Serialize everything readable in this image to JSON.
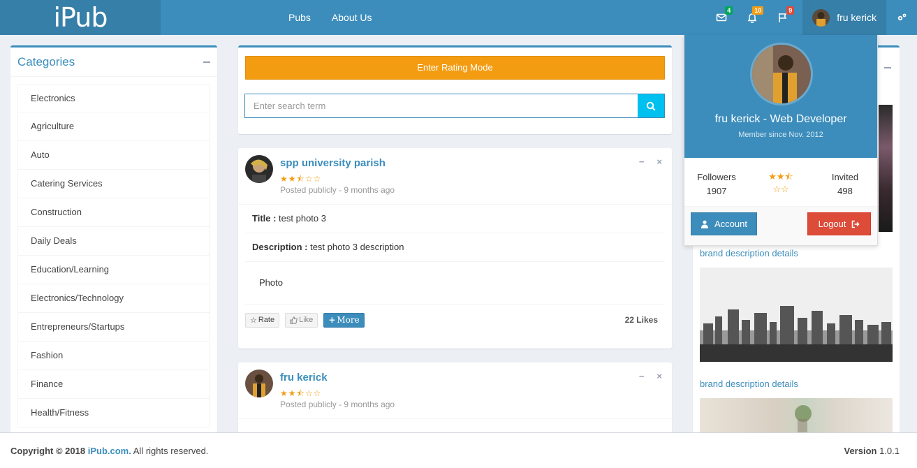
{
  "app": {
    "logo": "iPub"
  },
  "nav": {
    "links": [
      "Pubs",
      "About Us"
    ],
    "badges": {
      "messages": "4",
      "notifications": "10",
      "tasks": "9"
    },
    "user_name": "fru kerick",
    "colors": {
      "header": "#3c8dbc",
      "logo_bg": "#367fa9"
    }
  },
  "categories": {
    "title": "Categories",
    "items": [
      "Electronics",
      "Agriculture",
      "Auto",
      "Catering Services",
      "Construction",
      "Daily Deals",
      "Education/Learning",
      "Electronics/Technology",
      "Entrepreneurs/Startups",
      "Fashion",
      "Finance",
      "Health/Fitness"
    ]
  },
  "search": {
    "rating_button": "Enter Rating Mode",
    "placeholder": "Enter search term",
    "colors": {
      "rating": "#f39c12",
      "search_btn": "#00c0ef"
    }
  },
  "posts": [
    {
      "author": "spp university parish",
      "rating_stars": "★★⯪☆☆",
      "meta": "Posted publicly - 9 months ago",
      "title_label": "Title :",
      "title_value": " test photo 3",
      "desc_label": "Description :",
      "desc_value": " test photo 3 description",
      "media_label": "Photo",
      "rate_label": "Rate",
      "like_label": "Like",
      "more_label": "More",
      "likes": "22 Likes"
    },
    {
      "author": "fru kerick",
      "rating_stars": "★★⯪☆☆",
      "meta": "Posted publicly - 9 months ago"
    }
  ],
  "right_panel": {
    "brand_links": [
      "brand description details",
      "brand description details"
    ]
  },
  "user_dropdown": {
    "name": "fru kerick - Web Developer",
    "member_since": "Member since Nov. 2012",
    "followers_label": "Followers",
    "followers_value": "1907",
    "rating_top": "★★⯪",
    "rating_bottom": "☆☆",
    "invited_label": "Invited",
    "invited_value": "498",
    "account_label": "Account",
    "logout_label": "Logout"
  },
  "footer": {
    "copyright_prefix": "Copyright © 2018",
    "site": "iPub.com.",
    "rights": "All rights reserved.",
    "version_label": "Version",
    "version_value": "1.0.1"
  }
}
